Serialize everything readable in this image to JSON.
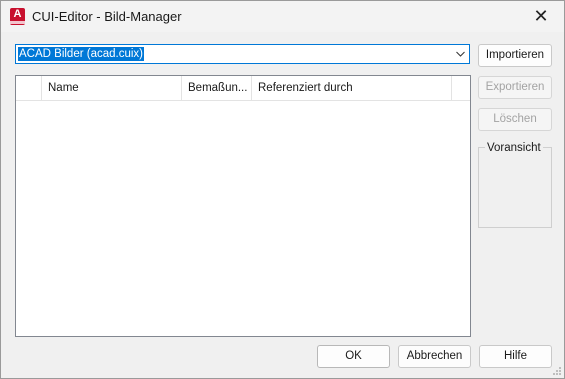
{
  "window": {
    "title": "CUI-Editor - Bild-Manager",
    "app_icon_letter": "A",
    "close_glyph": "✕"
  },
  "combo": {
    "value": "ACAD Bilder (acad.cuix)",
    "icon": "chevron-down-icon"
  },
  "list": {
    "columns": [
      "",
      "Name",
      "Bemaßun...",
      "Referenziert durch"
    ],
    "rows": []
  },
  "side_buttons": {
    "import": "Importieren",
    "export": "Exportieren",
    "delete": "Löschen"
  },
  "preview": {
    "label": "Voransicht"
  },
  "footer": {
    "ok": "OK",
    "cancel": "Abbrechen",
    "help": "Hilfe"
  },
  "colors": {
    "accent": "#0078d7",
    "app_icon": "#c8102e"
  }
}
